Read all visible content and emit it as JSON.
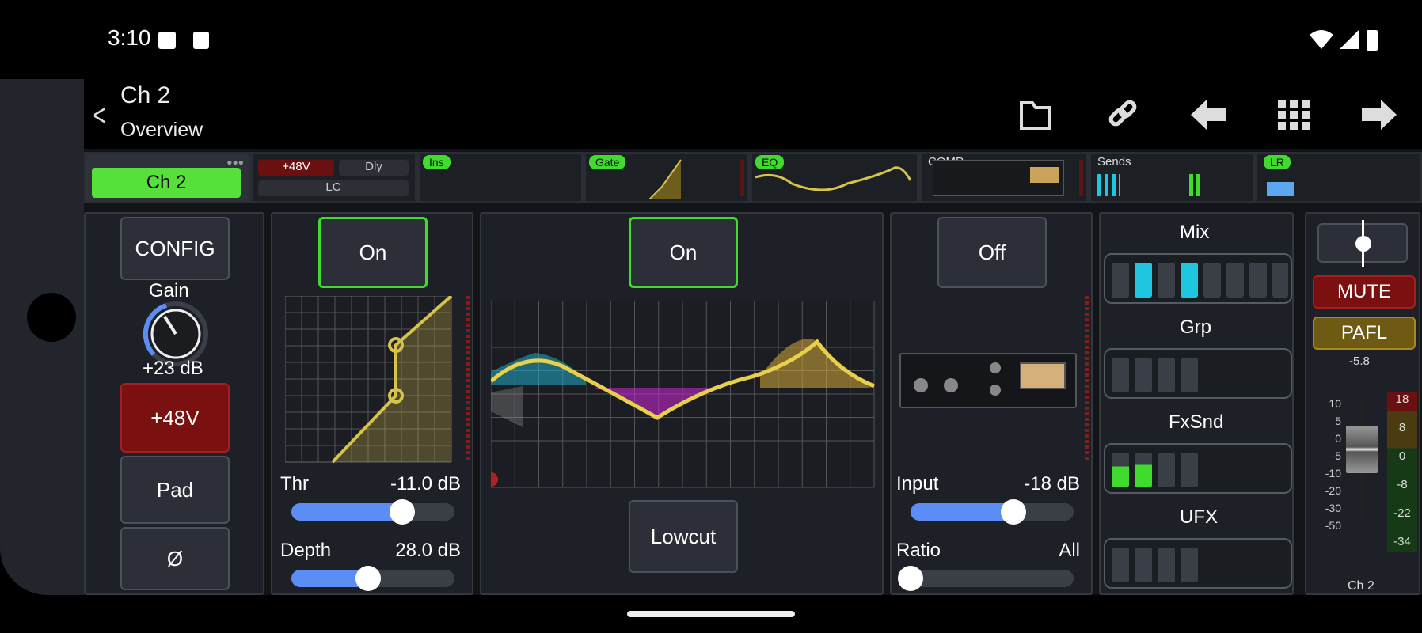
{
  "status_bar": {
    "time": "3:10"
  },
  "header": {
    "channel": "Ch 2",
    "subtitle": "Overview"
  },
  "toolbar": [
    "folder-icon",
    "link-icon",
    "arrow-left-icon",
    "grid-icon",
    "arrow-right-icon"
  ],
  "strip": {
    "channel_button": "Ch 2",
    "phantom": "+48V",
    "delay": "Dly",
    "lowcut": "LC",
    "ins": "Ins",
    "gate": "Gate",
    "eq": "EQ",
    "comp": "COMP",
    "sends": "Sends",
    "lr": "LR"
  },
  "config_panel": {
    "config": "CONFIG",
    "gain_label": "Gain",
    "gain_value": "+23 dB",
    "phantom": "+48V",
    "pad": "Pad",
    "phase": "Ø"
  },
  "gate_panel": {
    "on": "On",
    "thr_label": "Thr",
    "thr_value": "-11.0 dB",
    "thr_level": 0.68,
    "depth_label": "Depth",
    "depth_value": "28.0 dB",
    "depth_level": 0.47
  },
  "eq_panel": {
    "on": "On",
    "lowcut": "Lowcut"
  },
  "comp_panel": {
    "off": "Off",
    "input_label": "Input",
    "input_value": "-18 dB",
    "input_level": 0.63,
    "ratio_label": "Ratio",
    "ratio_value": "All",
    "ratio_level": 0.0
  },
  "sends_panel": {
    "mix": "Mix",
    "grp": "Grp",
    "fxsnd": "FxSnd",
    "ufx": "UFX"
  },
  "fader_panel": {
    "mute": "MUTE",
    "pafl": "PAFL",
    "level": "-5.8",
    "scale": [
      "10",
      "5",
      "0",
      "-5",
      "-10",
      "-20",
      "-30",
      "-50"
    ],
    "meter_scale": [
      "18",
      "8",
      "0",
      "-8",
      "-22",
      "-34"
    ],
    "channel": "Ch 2"
  },
  "colors": {
    "accent_green": "#3fdc2e",
    "slider_blue": "#5b8df5",
    "mute_red": "#8a1414",
    "pafl_gold": "#6e5a12"
  }
}
